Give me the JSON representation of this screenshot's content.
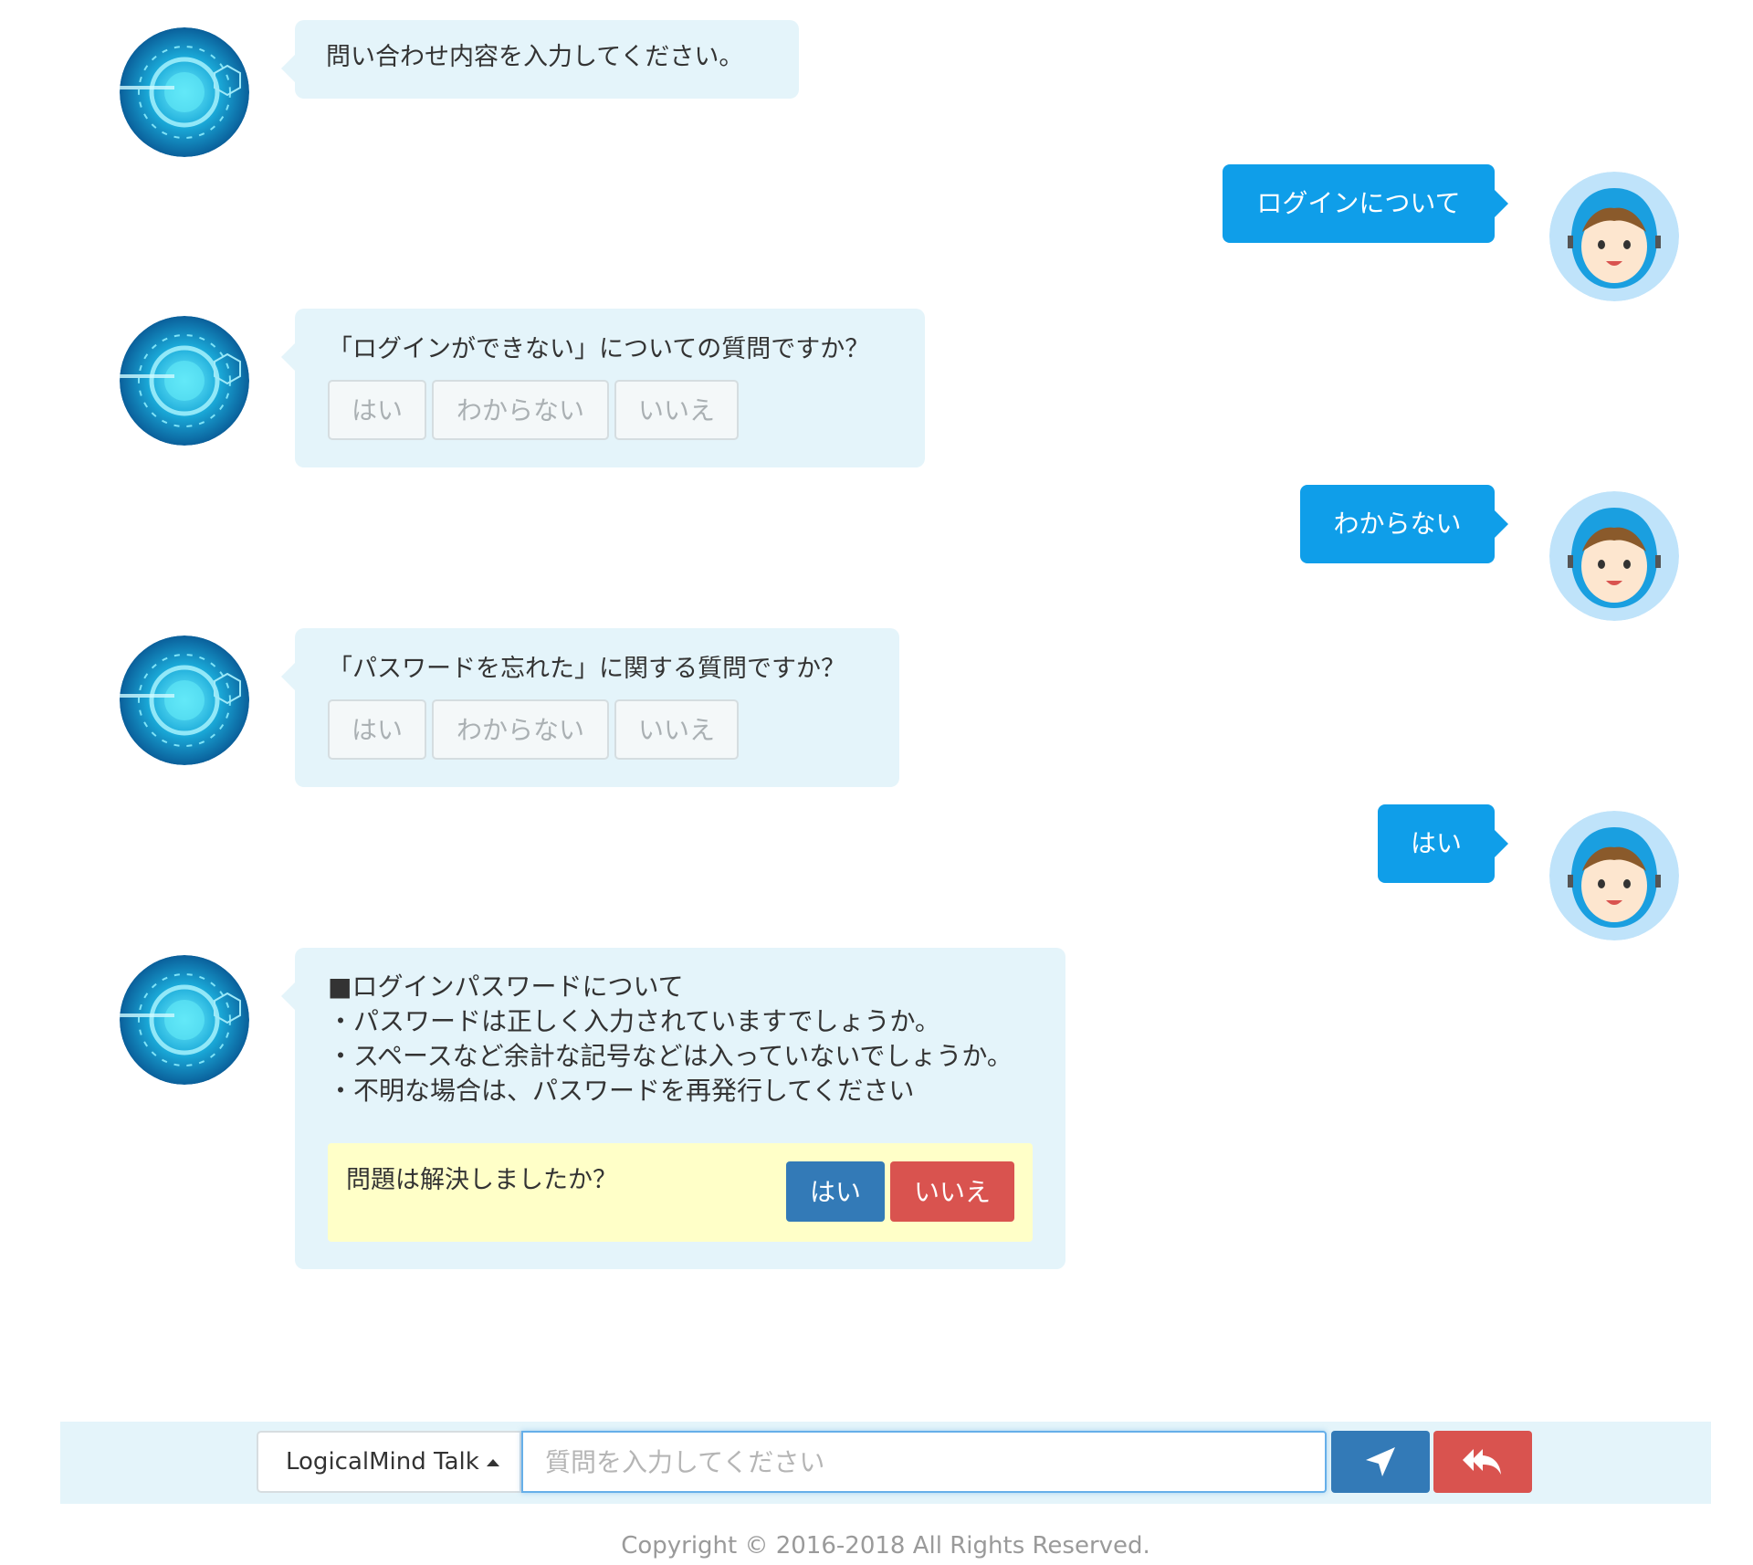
{
  "colors": {
    "bot_bubble": "#e4f4fa",
    "user_bubble": "#0f9ee9",
    "resolve_box": "#ffffc8",
    "primary": "#337ab7",
    "danger": "#d9534f"
  },
  "icons": {
    "bot_avatar": "tech-globe-avatar",
    "user_avatar": "hooded-girl-avatar",
    "send": "paper-plane-icon",
    "back": "reply-all-icon"
  },
  "conversation": {
    "bot1": {
      "text": "問い合わせ内容を入力してください。"
    },
    "user1": {
      "text": "ログインについて"
    },
    "bot2": {
      "text": "「ログインができない」についての質問ですか？",
      "choices": [
        "はい",
        "わからない",
        "いいえ"
      ]
    },
    "user2": {
      "text": "わからない"
    },
    "bot3": {
      "text": "「パスワードを忘れた」に関する質問ですか？",
      "choices": [
        "はい",
        "わからない",
        "いいえ"
      ]
    },
    "user3": {
      "text": "はい"
    },
    "bot4": {
      "lines": [
        "■ログインパスワードについて",
        "・パスワードは正しく入力されていますでしょうか。",
        "・スペースなど余計な記号などは入っていないでしょうか。",
        "・不明な場合は、パスワードを再発行してください"
      ],
      "resolve_question": "問題は解決しましたか？",
      "resolve_yes": "はい",
      "resolve_no": "いいえ"
    }
  },
  "input_bar": {
    "mode_label": "LogicalMind Talk",
    "placeholder": "質問を入力してください"
  },
  "footer": {
    "copyright": "Copyright © 2016-2018 All Rights Reserved."
  }
}
